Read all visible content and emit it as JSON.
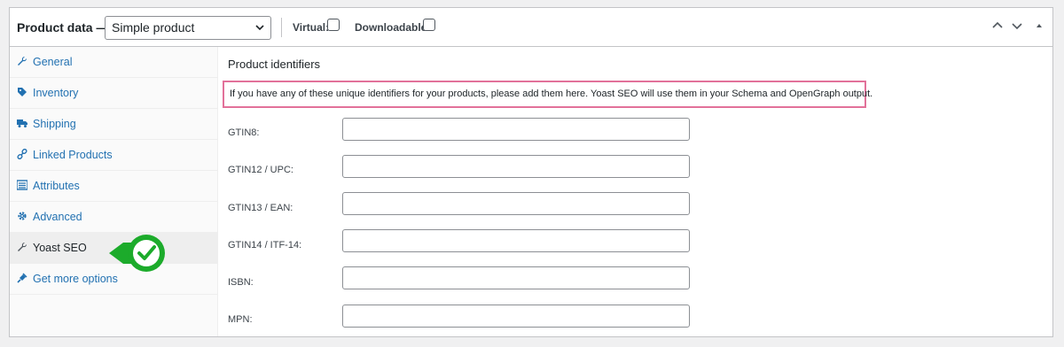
{
  "header": {
    "title": "Product data —",
    "product_type": "Simple product",
    "virtual_label": "Virtual:",
    "downloadable_label": "Downloadable:"
  },
  "sidebar": {
    "items": [
      {
        "label": "General",
        "icon": "wrench-icon"
      },
      {
        "label": "Inventory",
        "icon": "tag-icon"
      },
      {
        "label": "Shipping",
        "icon": "truck-icon"
      },
      {
        "label": "Linked Products",
        "icon": "link-icon"
      },
      {
        "label": "Attributes",
        "icon": "list-icon"
      },
      {
        "label": "Advanced",
        "icon": "gear-icon"
      },
      {
        "label": "Yoast SEO",
        "icon": "wrench-icon",
        "active": true
      },
      {
        "label": "Get more options",
        "icon": "plugin-icon"
      }
    ]
  },
  "panel": {
    "section_title": "Product identifiers",
    "notice": "If you have any of these unique identifiers for your products, please add them here. Yoast SEO will use them in your Schema and OpenGraph output.",
    "fields": [
      {
        "label": "GTIN8:",
        "value": ""
      },
      {
        "label": "GTIN12 / UPC:",
        "value": ""
      },
      {
        "label": "GTIN13 / EAN:",
        "value": ""
      },
      {
        "label": "GTIN14 / ITF-14:",
        "value": ""
      },
      {
        "label": "ISBN:",
        "value": ""
      },
      {
        "label": "MPN:",
        "value": ""
      }
    ]
  },
  "colors": {
    "link": "#2271b1",
    "notice_border": "#e2719a",
    "badge_green": "#1cab2b"
  }
}
